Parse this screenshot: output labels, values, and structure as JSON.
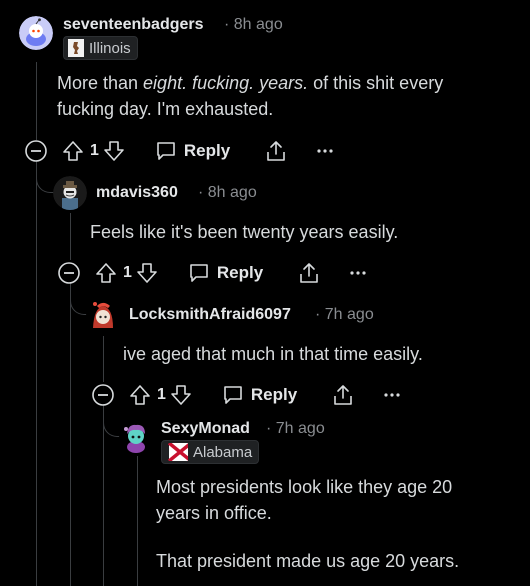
{
  "comments": [
    {
      "username": "seventeenbadgers",
      "time": "8h ago",
      "flair": "Illinois",
      "body_parts": [
        "More than ",
        "eight. fucking. years.",
        " of this shit every fucking day. I'm exhausted."
      ],
      "votes": "1",
      "reply_label": "Reply"
    },
    {
      "username": "mdavis360",
      "time": "8h ago",
      "body": "Feels like it's been twenty years easily.",
      "votes": "1",
      "reply_label": "Reply"
    },
    {
      "username": "LocksmithAfraid6097",
      "time": "7h ago",
      "body": "ive aged that much in that time easily.",
      "votes": "1",
      "reply_label": "Reply"
    },
    {
      "username": "SexyMonad",
      "time": "7h ago",
      "flair": "Alabama",
      "body_p1": "Most presidents look like they age 20 years in office.",
      "body_p2": "That president made us age 20 years."
    }
  ],
  "separator": "·",
  "icons": {
    "collapse": "minus-circle-icon",
    "upvote": "upvote-arrow-icon",
    "downvote": "downvote-arrow-icon",
    "reply": "speech-bubble-icon",
    "share": "share-icon",
    "more": "ellipsis-icon"
  },
  "colors": {
    "background": "#000000",
    "text": "#d7dadc",
    "muted": "#8a8d91",
    "thread_line": "#3a3d40",
    "flair_bg": "#1f2123"
  }
}
